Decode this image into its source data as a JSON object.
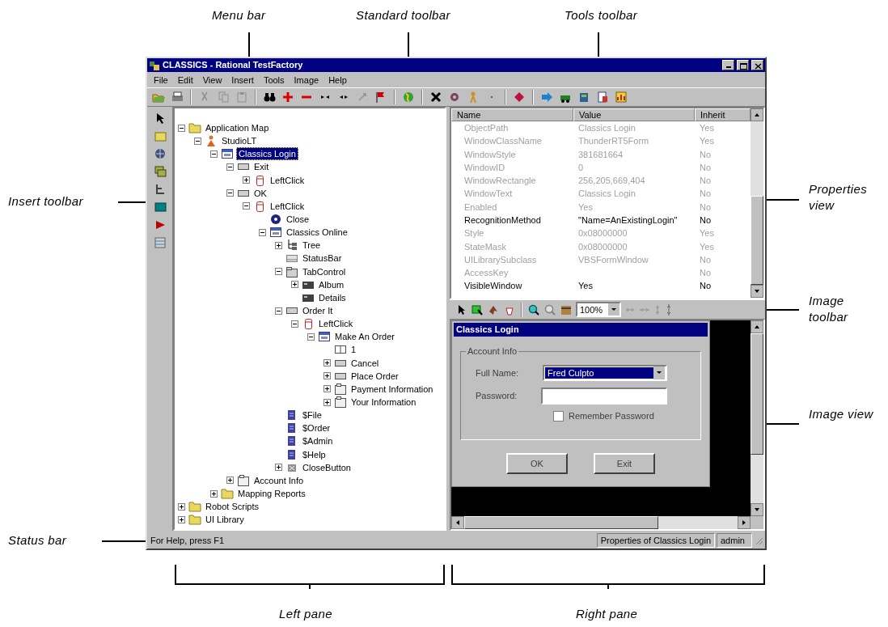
{
  "annotations": {
    "menu_bar": "Menu bar",
    "standard_toolbar": "Standard toolbar",
    "tools_toolbar": "Tools toolbar",
    "insert_toolbar": "Insert toolbar",
    "properties_view": "Properties view",
    "image_toolbar": "Image toolbar",
    "image_view": "Image view",
    "status_bar": "Status bar",
    "left_pane": "Left pane",
    "right_pane": "Right pane"
  },
  "window": {
    "title": "CLASSICS - Rational TestFactory",
    "menu": [
      "File",
      "Edit",
      "View",
      "Insert",
      "Tools",
      "Image",
      "Help"
    ],
    "tree": [
      {
        "label": "Application Map",
        "kind": "folder",
        "expanded": true,
        "selected": false,
        "children": [
          {
            "label": "StudioLT",
            "kind": "app",
            "expanded": true,
            "selected": false,
            "children": [
              {
                "label": "Classics Login",
                "kind": "window",
                "expanded": true,
                "selected": true,
                "children": [
                  {
                    "label": "Exit",
                    "kind": "button",
                    "expanded": true,
                    "selected": false,
                    "children": [
                      {
                        "label": "LeftClick",
                        "kind": "action",
                        "expanded": false,
                        "selected": false
                      }
                    ]
                  },
                  {
                    "label": "OK",
                    "kind": "button",
                    "expanded": true,
                    "selected": false,
                    "children": [
                      {
                        "label": "LeftClick",
                        "kind": "action",
                        "expanded": true,
                        "selected": false,
                        "children": [
                          {
                            "label": "Close",
                            "kind": "close",
                            "selected": false
                          },
                          {
                            "label": "Classics Online",
                            "kind": "window",
                            "expanded": true,
                            "selected": false,
                            "children": [
                              {
                                "label": "Tree",
                                "kind": "tree",
                                "expanded": false,
                                "selected": false
                              },
                              {
                                "label": "StatusBar",
                                "kind": "statusbar",
                                "selected": false
                              },
                              {
                                "label": "TabControl",
                                "kind": "tab",
                                "expanded": true,
                                "selected": false,
                                "children": [
                                  {
                                    "label": "Album",
                                    "kind": "tabpage",
                                    "expanded": false,
                                    "selected": false
                                  },
                                  {
                                    "label": "Details",
                                    "kind": "tabpage",
                                    "selected": false
                                  }
                                ]
                              },
                              {
                                "label": "Order It",
                                "kind": "button",
                                "expanded": true,
                                "selected": false,
                                "children": [
                                  {
                                    "label": "LeftClick",
                                    "kind": "action",
                                    "expanded": true,
                                    "selected": false,
                                    "children": [
                                      {
                                        "label": "Make An Order",
                                        "kind": "window",
                                        "expanded": true,
                                        "selected": false,
                                        "children": [
                                          {
                                            "label": "1",
                                            "kind": "label",
                                            "selected": false
                                          },
                                          {
                                            "label": "Cancel",
                                            "kind": "button",
                                            "expanded": false,
                                            "selected": false
                                          },
                                          {
                                            "label": "Place Order",
                                            "kind": "button",
                                            "expanded": false,
                                            "selected": false
                                          },
                                          {
                                            "label": "Payment Information",
                                            "kind": "group",
                                            "expanded": false,
                                            "selected": false
                                          },
                                          {
                                            "label": "Your Information",
                                            "kind": "group",
                                            "expanded": false,
                                            "selected": false
                                          }
                                        ]
                                      }
                                    ]
                                  }
                                ]
                              },
                              {
                                "label": "$File",
                                "kind": "menu",
                                "selected": false
                              },
                              {
                                "label": "$Order",
                                "kind": "menu",
                                "selected": false
                              },
                              {
                                "label": "$Admin",
                                "kind": "menu",
                                "selected": false
                              },
                              {
                                "label": "$Help",
                                "kind": "menu",
                                "selected": false
                              },
                              {
                                "label": "CloseButton",
                                "kind": "closebutton",
                                "expanded": false,
                                "selected": false
                              }
                            ]
                          }
                        ]
                      }
                    ]
                  },
                  {
                    "label": "Account Info",
                    "kind": "group",
                    "expanded": false,
                    "selected": false
                  }
                ]
              },
              {
                "label": "Mapping Reports",
                "kind": "folder",
                "expanded": false,
                "selected": false
              }
            ]
          }
        ]
      },
      {
        "label": "Robot Scripts",
        "kind": "folder",
        "expanded": false,
        "selected": false
      },
      {
        "label": "UI Library",
        "kind": "folder",
        "expanded": false,
        "selected": false
      }
    ],
    "properties": {
      "columns": [
        "Name",
        "Value",
        "Inherit"
      ],
      "rows": [
        {
          "name": "ObjectPath",
          "value": "Classics Login",
          "inherit": "Yes",
          "highlighted": false
        },
        {
          "name": "WindowClassName",
          "value": "ThunderRT5Form",
          "inherit": "Yes",
          "highlighted": false
        },
        {
          "name": "WindowStyle",
          "value": "381681664",
          "inherit": "No",
          "highlighted": false
        },
        {
          "name": "WindowID",
          "value": "0",
          "inherit": "No",
          "highlighted": false
        },
        {
          "name": "WindowRectangle",
          "value": "256,205,669,404",
          "inherit": "No",
          "highlighted": false
        },
        {
          "name": "WindowText",
          "value": "Classics Login",
          "inherit": "No",
          "highlighted": false
        },
        {
          "name": "Enabled",
          "value": "Yes",
          "inherit": "No",
          "highlighted": false
        },
        {
          "name": "RecognitionMethod",
          "value": "\"Name=AnExistingLogin\"",
          "inherit": "No",
          "highlighted": true
        },
        {
          "name": "Style",
          "value": "0x08000000",
          "inherit": "Yes",
          "highlighted": false
        },
        {
          "name": "StateMask",
          "value": "0x08000000",
          "inherit": "Yes",
          "highlighted": false
        },
        {
          "name": "UILibrarySubclass",
          "value": "VBSFormWindow",
          "inherit": "No",
          "highlighted": false
        },
        {
          "name": "AccessKey",
          "inherit": "No",
          "highlighted": false
        },
        {
          "name": "VisibleWindow",
          "value": "Yes",
          "inherit": "No",
          "highlighted": true
        }
      ]
    },
    "image_toolbar": {
      "zoom": "100%"
    },
    "dialog": {
      "title": "Classics Login",
      "group": "Account Info",
      "full_name_label": "Full Name:",
      "full_name_value": "Fred Culpto",
      "password_label": "Password:",
      "remember": {
        "label": "Remember Password",
        "checked": false
      },
      "buttons": [
        "OK",
        "Exit"
      ]
    },
    "status_bar": [
      "For Help, press F1",
      "Properties of Classics Login",
      "admin"
    ]
  }
}
